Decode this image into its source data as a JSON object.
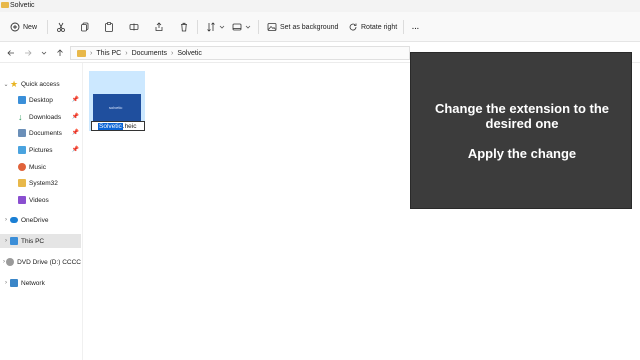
{
  "window": {
    "title": "Solvetic"
  },
  "toolbar": {
    "new_label": "New",
    "set_background_label": "Set as background",
    "rotate_right_label": "Rotate right",
    "more_label": "..."
  },
  "address": {
    "crumbs": [
      "This PC",
      "Documents",
      "Solvetic"
    ]
  },
  "sidebar": {
    "items": [
      {
        "label": "Quick access",
        "icon": "star-icon",
        "expandable": true,
        "pinned": false,
        "selected": false
      },
      {
        "label": "Desktop",
        "icon": "desktop-icon",
        "expandable": false,
        "pinned": true,
        "selected": false
      },
      {
        "label": "Downloads",
        "icon": "download-icon",
        "expandable": false,
        "pinned": true,
        "selected": false
      },
      {
        "label": "Documents",
        "icon": "documents-icon",
        "expandable": false,
        "pinned": true,
        "selected": false
      },
      {
        "label": "Pictures",
        "icon": "pictures-icon",
        "expandable": false,
        "pinned": true,
        "selected": false
      },
      {
        "label": "Music",
        "icon": "music-icon",
        "expandable": false,
        "pinned": false,
        "selected": false
      },
      {
        "label": "System32",
        "icon": "folder-icon",
        "expandable": false,
        "pinned": false,
        "selected": false
      },
      {
        "label": "Videos",
        "icon": "videos-icon",
        "expandable": false,
        "pinned": false,
        "selected": false
      },
      {
        "label": "OneDrive",
        "icon": "cloud-icon",
        "expandable": true,
        "pinned": false,
        "selected": false
      },
      {
        "label": "This PC",
        "icon": "pc-icon",
        "expandable": true,
        "pinned": false,
        "selected": true
      },
      {
        "label": "DVD Drive (D:) CCCC",
        "icon": "dvd-icon",
        "expandable": true,
        "pinned": false,
        "selected": false
      },
      {
        "label": "Network",
        "icon": "network-icon",
        "expandable": true,
        "pinned": false,
        "selected": false
      }
    ]
  },
  "file": {
    "rename_selected": "Solvetic",
    "rename_extension": ".heic",
    "thumb_text": "solvetic"
  },
  "overlay": {
    "line1": "Change the extension to the",
    "line2": "desired one",
    "line3": "Apply the change"
  },
  "colors": {
    "accent": "#0a64d6",
    "selection_tile": "#cce8ff",
    "overlay_bg": "#3c3c3c",
    "folder": "#e8b84a"
  }
}
